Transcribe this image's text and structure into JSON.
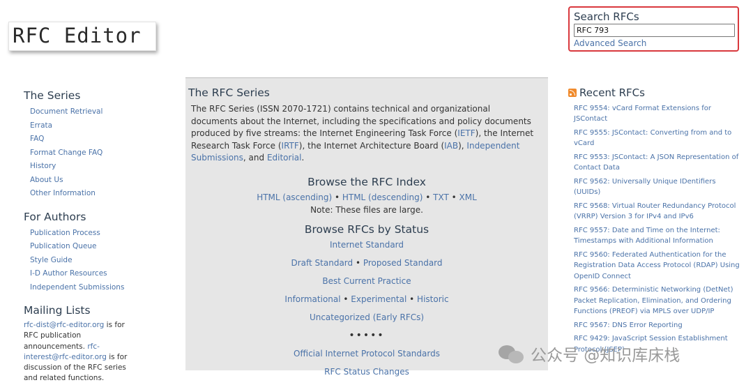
{
  "logo": {
    "text": "RFC Editor"
  },
  "search": {
    "title": "Search RFCs",
    "value": "RFC 793",
    "advanced_label": "Advanced Search"
  },
  "left": {
    "series": {
      "heading": "The Series",
      "items": [
        "Document Retrieval",
        "Errata",
        "FAQ",
        "Format Change FAQ",
        "History",
        "About Us",
        "Other Information"
      ]
    },
    "authors": {
      "heading": "For Authors",
      "items": [
        "Publication Process",
        "Publication Queue",
        "Style Guide",
        "I-D Author Resources",
        "Independent Submissions"
      ]
    },
    "mailing": {
      "heading": "Mailing Lists",
      "dist_email": "rfc-dist@rfc-editor.org",
      "dist_text": " is for RFC publication announcements. ",
      "interest_email": "rfc-interest@rfc-editor.org",
      "interest_text": " is for discussion of the RFC series and related functions."
    }
  },
  "main": {
    "title": "The RFC Series",
    "intro": {
      "p1": "The RFC Series (ISSN 2070-1721) contains technical and organizational documents about the Internet, including the specifications and policy documents produced by five streams: the Internet Engineering Task Force (",
      "ietf": "IETF",
      "p2": "), the Internet Research Task Force (",
      "irtf": "IRTF",
      "p3": "), the Internet Architecture Board (",
      "iab": "IAB",
      "p4": "), ",
      "independent": "Independent Submissions",
      "p5": ", and ",
      "editorial": "Editorial",
      "p6": "."
    },
    "index": {
      "heading": "Browse the RFC Index",
      "html_asc": "HTML (ascending)",
      "html_desc": "HTML (descending)",
      "txt": "TXT",
      "xml": "XML",
      "note": "Note: These files are large."
    },
    "status": {
      "heading": "Browse RFCs by Status",
      "internet_standard": "Internet Standard",
      "draft_standard": "Draft Standard",
      "proposed_standard": "Proposed Standard",
      "best_current": "Best Current Practice",
      "informational": "Informational",
      "experimental": "Experimental",
      "historic": "Historic",
      "uncategorized": "Uncategorized (Early RFCs)",
      "dots": "•••••",
      "official": "Official Internet Protocol Standards",
      "status_changes": "RFC Status Changes"
    },
    "bullet": " • "
  },
  "recent": {
    "heading": "Recent RFCs",
    "items": [
      "RFC 9554: vCard Format Extensions for JSContact",
      "RFC 9555: JSContact: Converting from and to vCard",
      "RFC 9553: JSContact: A JSON Representation of Contact Data",
      "RFC 9562: Universally Unique IDentifiers (UUIDs)",
      "RFC 9568: Virtual Router Redundancy Protocol (VRRP) Version 3 for IPv4 and IPv6",
      "RFC 9557: Date and Time on the Internet: Timestamps with Additional Information",
      "RFC 9560: Federated Authentication for the Registration Data Access Protocol (RDAP) Using OpenID Connect",
      "RFC 9566: Deterministic Networking (DetNet) Packet Replication, Elimination, and Ordering Functions (PREOF) via MPLS over UDP/IP",
      "RFC 9567: DNS Error Reporting",
      "RFC 9429: JavaScript Session Establishment Protocol (JSEP)"
    ]
  },
  "watermark": {
    "text": "公众号 @知识库床栈"
  },
  "colors": {
    "link": "#4a72a8",
    "heading": "#2d3e50",
    "panel_bg": "#e6e6e6",
    "search_border": "#d9383d",
    "rss": "#f08a2c"
  }
}
